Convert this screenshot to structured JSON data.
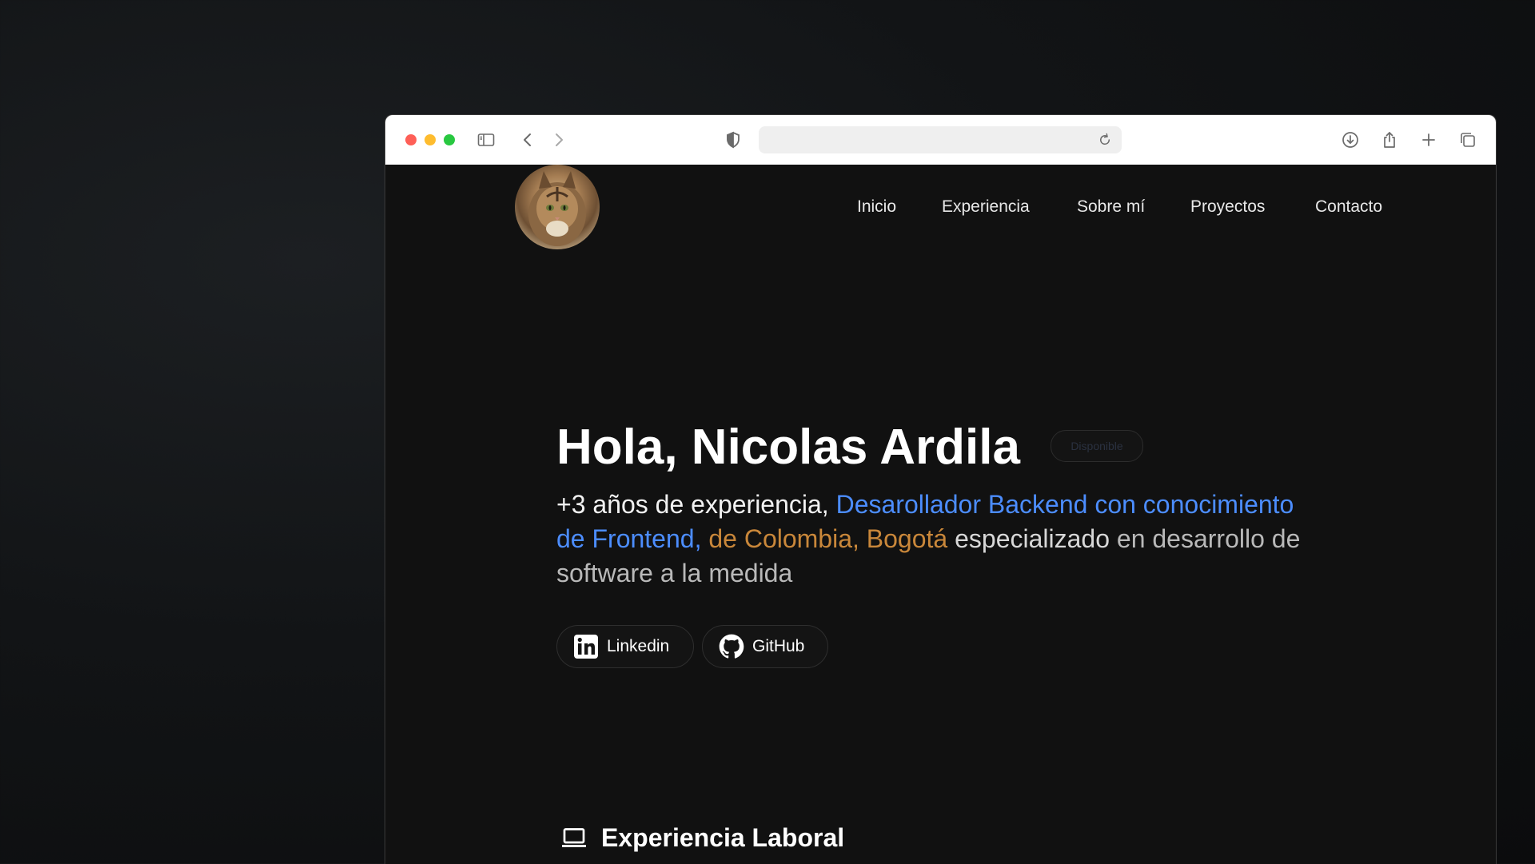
{
  "nav": {
    "items": [
      {
        "label": "Inicio"
      },
      {
        "label": "Experiencia"
      },
      {
        "label": "Sobre mí"
      },
      {
        "label": "Proyectos"
      },
      {
        "label": "Contacto"
      }
    ]
  },
  "hero": {
    "title": "Hola, Nicolas Ardila",
    "badge": "Disponible",
    "desc": {
      "part1": "+3 años de experiencia, ",
      "highlight_role": "Desarollador Backend con conocimiento de Frontend,",
      "space": " ",
      "highlight_location": "de Colombia, Bogotá",
      "part2": " especializado",
      "part3": " en desarrollo de software a la medida"
    }
  },
  "social": {
    "linkedin": "Linkedin",
    "github": "GitHub"
  },
  "section": {
    "title": "Experiencia Laboral",
    "icon": "laptop-icon"
  },
  "colors": {
    "accent_blue": "#4c8dff",
    "accent_gold": "#c9873a",
    "background": "#111111"
  }
}
